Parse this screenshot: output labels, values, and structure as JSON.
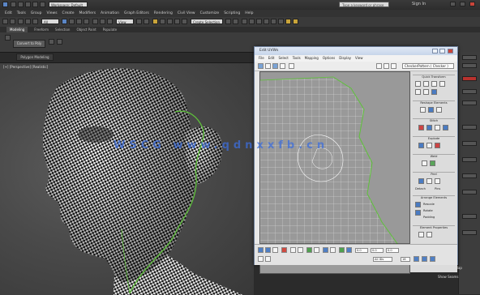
{
  "app": {
    "title": "Workspace: Default",
    "search_placeholder": "Type a keyword or phrase",
    "user": "Sign In"
  },
  "menubar": [
    "Edit",
    "Tools",
    "Group",
    "Views",
    "Create",
    "Modifiers",
    "Animation",
    "Graph Editors",
    "Rendering",
    "Civil View",
    "Customize",
    "Scripting",
    "Help"
  ],
  "toolbar": {
    "selection_filter": "All",
    "view_dropdown": "View",
    "named_selection": "Create Selection Se"
  },
  "ribbon": {
    "tabs": [
      "Modeling",
      "Freeform",
      "Selection",
      "Object Paint",
      "Populate"
    ],
    "active_tab": "Modeling",
    "poly_button": "Convert to Poly",
    "panel_label": "Polygon Modeling"
  },
  "viewport": {
    "label": "[+] [Perspective] [Realistic]"
  },
  "uvw_editor": {
    "title": "Edit UVWs",
    "menu": [
      "File",
      "Edit",
      "Select",
      "Tools",
      "Mapping",
      "Options",
      "Display",
      "View"
    ],
    "map_dropdown": "CheckerPattern ( Checker )",
    "sections": [
      "Quick Transform",
      "Reshape Elements",
      "Stitch",
      "Explode",
      "Weld",
      "Peel",
      "Arrange Elements",
      "Element Properties"
    ],
    "options": {
      "detach": "Detach",
      "pins": "Pins",
      "rescale": "Rescale",
      "rotate": "Rotate",
      "padding": "Padding"
    },
    "bottom": {
      "u": "0.0",
      "v": "0.0",
      "w": "0.0",
      "allids": "All IDs",
      "zoom": "16"
    }
  },
  "command_panel": {
    "items": [
      "Normalize Map",
      "Show Seams"
    ]
  },
  "watermark": "WSCG  www.qdnxxfb.cn",
  "colors": {
    "ui_dark": "#2b2b2b",
    "uvw_window_bg": "#e8e8e8",
    "seam_green": "#5ec23a",
    "accent_blue": "#4a7bc2"
  }
}
